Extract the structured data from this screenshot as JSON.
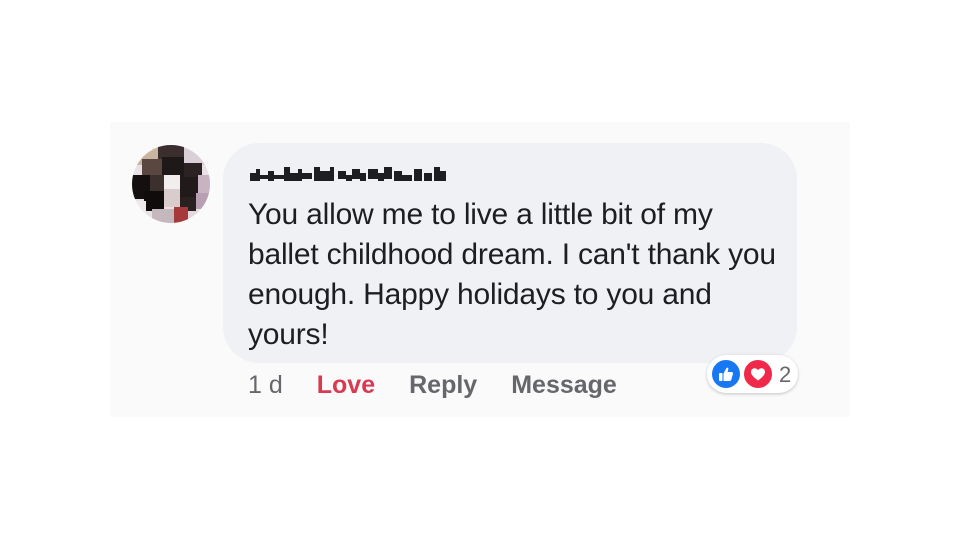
{
  "comment": {
    "author_name": "",
    "text": "You allow me to live a little bit of my ballet childhood dream. I can't thank you enough. Happy holidays to you and yours!",
    "timestamp": "1 d",
    "actions": {
      "love_label": "Love",
      "reply_label": "Reply",
      "message_label": "Message"
    },
    "reactions": {
      "icons": [
        "like-icon",
        "heart-icon"
      ],
      "count": "2"
    }
  },
  "colors": {
    "bubble_bg": "#eff1f4",
    "love_active": "#d83a52",
    "like_blue": "#1877f2",
    "heart_red": "#f0284a",
    "muted_text": "#65676b"
  }
}
